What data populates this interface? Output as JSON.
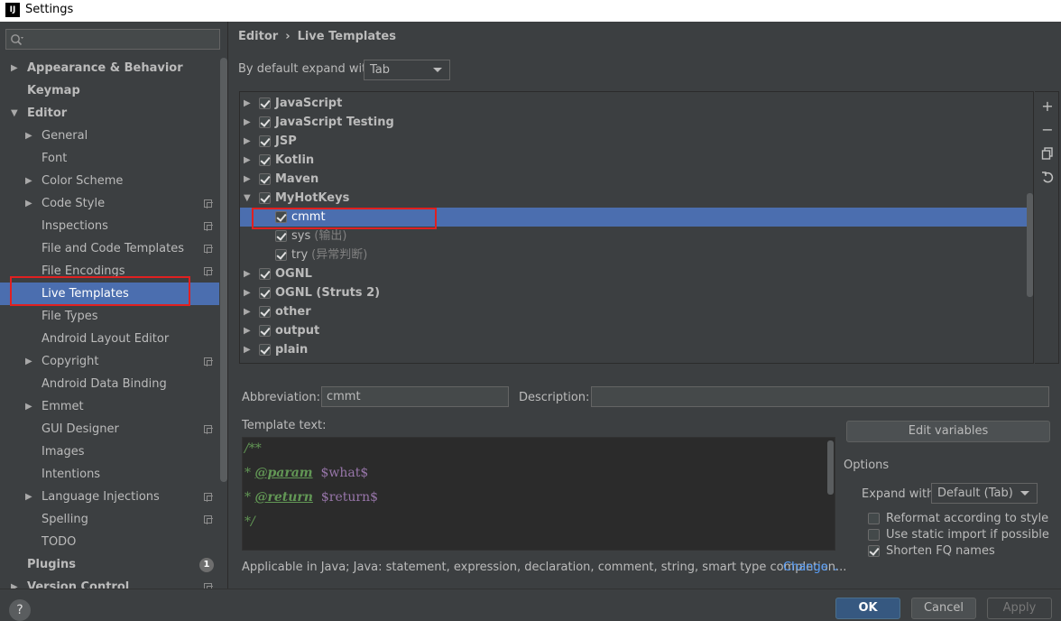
{
  "window": {
    "title": "Settings",
    "logo": "IJ"
  },
  "sidebar": {
    "search_placeholder": "",
    "items": [
      {
        "label": "Appearance & Behavior",
        "bold": true,
        "level": 0,
        "arrow": "right"
      },
      {
        "label": "Keymap",
        "bold": true,
        "level": 0,
        "arrow": ""
      },
      {
        "label": "Editor",
        "bold": true,
        "level": 0,
        "arrow": "down"
      },
      {
        "label": "General",
        "level": 1,
        "arrow": "right"
      },
      {
        "label": "Font",
        "level": 1,
        "arrow": ""
      },
      {
        "label": "Color Scheme",
        "level": 1,
        "arrow": "right"
      },
      {
        "label": "Code Style",
        "level": 1,
        "arrow": "right",
        "project_icon": true
      },
      {
        "label": "Inspections",
        "level": 1,
        "arrow": "",
        "project_icon": true
      },
      {
        "label": "File and Code Templates",
        "level": 1,
        "arrow": "",
        "project_icon": true
      },
      {
        "label": "File Encodings",
        "level": 1,
        "arrow": "",
        "project_icon": true
      },
      {
        "label": "Live Templates",
        "level": 1,
        "arrow": "",
        "selected": true
      },
      {
        "label": "File Types",
        "level": 1,
        "arrow": ""
      },
      {
        "label": "Android Layout Editor",
        "level": 1,
        "arrow": ""
      },
      {
        "label": "Copyright",
        "level": 1,
        "arrow": "right",
        "project_icon": true
      },
      {
        "label": "Android Data Binding",
        "level": 1,
        "arrow": ""
      },
      {
        "label": "Emmet",
        "level": 1,
        "arrow": "right"
      },
      {
        "label": "GUI Designer",
        "level": 1,
        "arrow": "",
        "project_icon": true
      },
      {
        "label": "Images",
        "level": 1,
        "arrow": ""
      },
      {
        "label": "Intentions",
        "level": 1,
        "arrow": ""
      },
      {
        "label": "Language Injections",
        "level": 1,
        "arrow": "right",
        "project_icon": true
      },
      {
        "label": "Spelling",
        "level": 1,
        "arrow": "",
        "project_icon": true
      },
      {
        "label": "TODO",
        "level": 1,
        "arrow": ""
      },
      {
        "label": "Plugins",
        "bold": true,
        "level": 0,
        "arrow": "",
        "badge": "1"
      },
      {
        "label": "Version Control",
        "bold": true,
        "level": 0,
        "arrow": "right",
        "project_icon": true
      }
    ]
  },
  "breadcrumb": {
    "parent": "Editor",
    "separator": "›",
    "current": "Live Templates"
  },
  "expand": {
    "label": "By default expand with",
    "value": "Tab"
  },
  "template_groups": [
    {
      "label": "JavaScript",
      "bold": true,
      "level": 0,
      "arrow": "right",
      "checked": true
    },
    {
      "label": "JavaScript Testing",
      "bold": true,
      "level": 0,
      "arrow": "right",
      "checked": true
    },
    {
      "label": "JSP",
      "bold": true,
      "level": 0,
      "arrow": "right",
      "checked": true
    },
    {
      "label": "Kotlin",
      "bold": true,
      "level": 0,
      "arrow": "right",
      "checked": true
    },
    {
      "label": "Maven",
      "bold": true,
      "level": 0,
      "arrow": "right",
      "checked": true
    },
    {
      "label": "MyHotKeys",
      "bold": true,
      "level": 0,
      "arrow": "down",
      "checked": true
    },
    {
      "label": "cmmt",
      "level": 1,
      "checked": true,
      "selected": true,
      "desc": ""
    },
    {
      "label": "sys",
      "level": 1,
      "checked": true,
      "desc": "(输出)"
    },
    {
      "label": "try",
      "level": 1,
      "checked": true,
      "desc": "(异常判断)"
    },
    {
      "label": "OGNL",
      "bold": true,
      "level": 0,
      "arrow": "right",
      "checked": true
    },
    {
      "label": "OGNL (Struts 2)",
      "bold": true,
      "level": 0,
      "arrow": "right",
      "checked": true
    },
    {
      "label": "other",
      "bold": true,
      "level": 0,
      "arrow": "right",
      "checked": true
    },
    {
      "label": "output",
      "bold": true,
      "level": 0,
      "arrow": "right",
      "checked": true
    },
    {
      "label": "plain",
      "bold": true,
      "level": 0,
      "arrow": "right",
      "checked": true
    }
  ],
  "toolbar_icons": [
    "add-icon",
    "remove-icon",
    "copy-icon",
    "restore-icon"
  ],
  "form": {
    "abbreviation_label": "Abbreviation:",
    "abbreviation_value": "cmmt",
    "description_label": "Description:",
    "description_value": "",
    "template_text_label": "Template text:",
    "template_lines": [
      {
        "parts": [
          {
            "t": "/**",
            "c": "cmt"
          }
        ]
      },
      {
        "parts": [
          {
            "t": "* ",
            "c": "cmt"
          },
          {
            "t": "@param",
            "c": "tag"
          },
          {
            "t": "  ",
            "c": "cmt"
          },
          {
            "t": "$what$",
            "c": "var"
          }
        ]
      },
      {
        "parts": [
          {
            "t": "* ",
            "c": "cmt"
          },
          {
            "t": "@return",
            "c": "tag"
          },
          {
            "t": "  ",
            "c": "cmt"
          },
          {
            "t": "$return$",
            "c": "var"
          }
        ]
      },
      {
        "parts": [
          {
            "t": "*/",
            "c": "cmt"
          }
        ]
      }
    ],
    "edit_variables_label": "Edit variables",
    "applicable_text": "Applicable in Java; Java: statement, expression, declaration, comment, string, smart type completion...",
    "change_label": "Change"
  },
  "options": {
    "title": "Options",
    "expand_with_label": "Expand with",
    "expand_with_value": "Default (Tab)",
    "checkboxes": [
      {
        "label": "Reformat according to style",
        "checked": false
      },
      {
        "label": "Use static import if possible",
        "checked": false
      },
      {
        "label": "Shorten FQ names",
        "checked": true
      }
    ]
  },
  "buttons": {
    "help": "?",
    "ok": "OK",
    "cancel": "Cancel",
    "apply": "Apply"
  },
  "colors": {
    "selection": "#4b6eaf",
    "highlight_box": "#e02020",
    "background": "#3c3f41",
    "editor_bg": "#2b2b2b"
  }
}
